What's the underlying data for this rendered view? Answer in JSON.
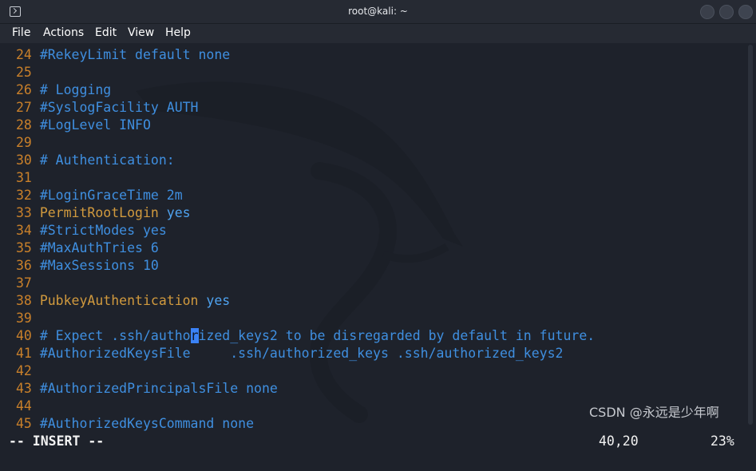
{
  "window": {
    "title": "root@kali: ~",
    "icon": "terminal-icon"
  },
  "menu": [
    "File",
    "Actions",
    "Edit",
    "View",
    "Help"
  ],
  "editor": {
    "lines": [
      {
        "num": "24",
        "parts": [
          {
            "t": "#RekeyLimit default none",
            "c": "cm"
          }
        ]
      },
      {
        "num": "25",
        "parts": []
      },
      {
        "num": "26",
        "parts": [
          {
            "t": "# Logging",
            "c": "cm"
          }
        ]
      },
      {
        "num": "27",
        "parts": [
          {
            "t": "#SyslogFacility AUTH",
            "c": "cm"
          }
        ]
      },
      {
        "num": "28",
        "parts": [
          {
            "t": "#LogLevel INFO",
            "c": "cm"
          }
        ]
      },
      {
        "num": "29",
        "parts": []
      },
      {
        "num": "30",
        "parts": [
          {
            "t": "# Authentication:",
            "c": "cm"
          }
        ]
      },
      {
        "num": "31",
        "parts": []
      },
      {
        "num": "32",
        "parts": [
          {
            "t": "#LoginGraceTime 2m",
            "c": "cm"
          }
        ]
      },
      {
        "num": "33",
        "parts": [
          {
            "t": "PermitRootLogin",
            "c": "kw"
          },
          {
            "t": " yes",
            "c": "val"
          }
        ]
      },
      {
        "num": "34",
        "parts": [
          {
            "t": "#StrictModes yes",
            "c": "cm"
          }
        ]
      },
      {
        "num": "35",
        "parts": [
          {
            "t": "#MaxAuthTries 6",
            "c": "cm"
          }
        ]
      },
      {
        "num": "36",
        "parts": [
          {
            "t": "#MaxSessions 10",
            "c": "cm"
          }
        ]
      },
      {
        "num": "37",
        "parts": []
      },
      {
        "num": "38",
        "parts": [
          {
            "t": "PubkeyAuthentication",
            "c": "kw"
          },
          {
            "t": " yes",
            "c": "val"
          }
        ]
      },
      {
        "num": "39",
        "parts": []
      },
      {
        "num": "40",
        "parts": [
          {
            "t": "# Expect .ssh/autho",
            "c": "cm"
          },
          {
            "t": "r",
            "c": "cursor"
          },
          {
            "t": "ized_keys2 to be disregarded by default in future.",
            "c": "cm"
          }
        ]
      },
      {
        "num": "41",
        "parts": [
          {
            "t": "#AuthorizedKeysFile     .ssh/authorized_keys .ssh/authorized_keys2",
            "c": "cm"
          }
        ]
      },
      {
        "num": "42",
        "parts": []
      },
      {
        "num": "43",
        "parts": [
          {
            "t": "#AuthorizedPrincipalsFile none",
            "c": "cm"
          }
        ]
      },
      {
        "num": "44",
        "parts": []
      },
      {
        "num": "45",
        "parts": [
          {
            "t": "#AuthorizedKeysCommand none",
            "c": "cm"
          }
        ]
      }
    ]
  },
  "status": {
    "mode": "-- INSERT --",
    "position": "40,20",
    "percent": "23%"
  },
  "watermark": "CSDN @永远是少年啊",
  "colors": {
    "background": "#1e222b",
    "line_number": "#c9802a",
    "comment": "#3f8fe0",
    "keyword": "#d19a3e",
    "value": "#4fa3f0",
    "cursor": "#3b82f6"
  }
}
